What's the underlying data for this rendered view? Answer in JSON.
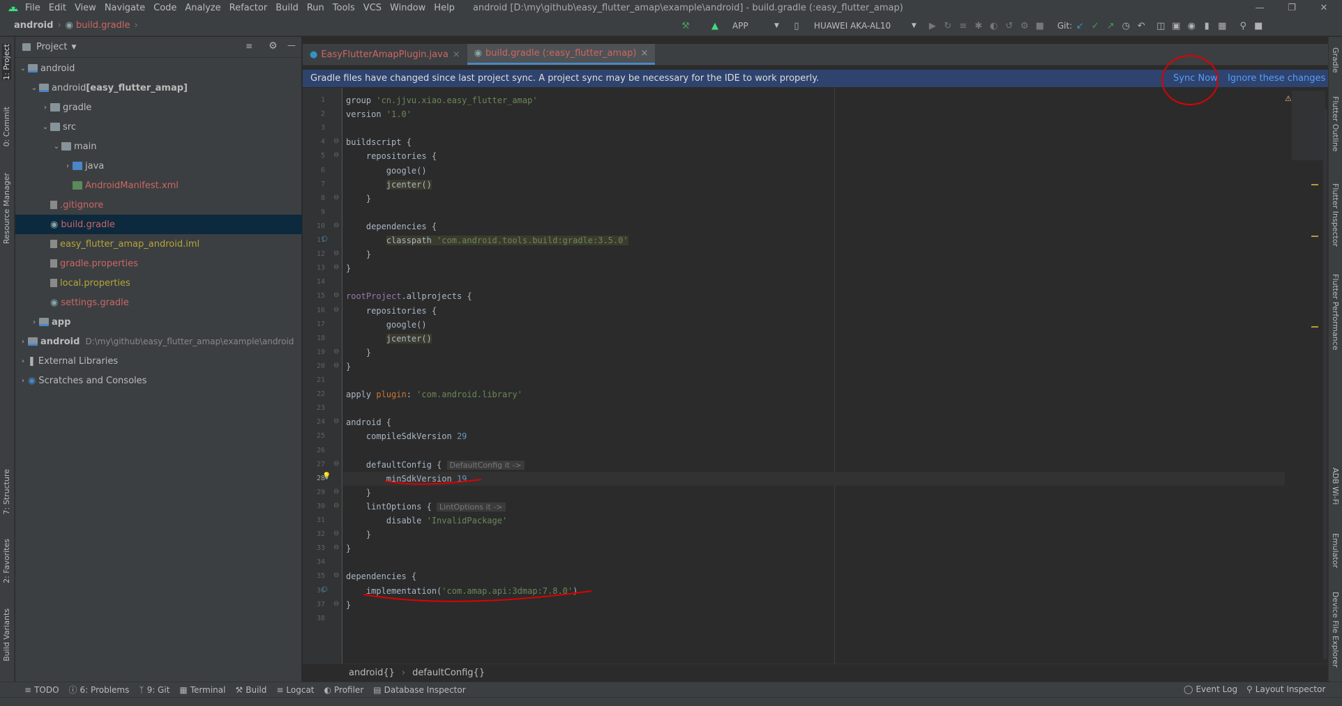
{
  "menubar": {
    "items": [
      "File",
      "Edit",
      "View",
      "Navigate",
      "Code",
      "Analyze",
      "Refactor",
      "Build",
      "Run",
      "Tools",
      "VCS",
      "Window",
      "Help"
    ],
    "window_title": "android [D:\\my\\github\\easy_flutter_amap\\example\\android] - build.gradle (:easy_flutter_amap)"
  },
  "navbar": {
    "crumb_root": "android",
    "crumb_file": "build.gradle",
    "run_config": "APP",
    "device": "HUAWEI AKA-AL10",
    "git_label": "Git:"
  },
  "left_strip": {
    "tabs": [
      "1: Project",
      "0: Commit",
      "Resource Manager",
      "7: Structure",
      "2: Favorites",
      "Build Variants"
    ]
  },
  "right_strip": {
    "tabs": [
      "Gradle",
      "Flutter Outline",
      "Flutter Inspector",
      "Flutter Performance",
      "ADB Wi-Fi",
      "Emulator",
      "Device File Explorer"
    ]
  },
  "project": {
    "title": "Project",
    "tree": [
      {
        "label": "android",
        "extra": "",
        "color": "#bbbbbb"
      },
      {
        "label": "android",
        "extra": " [easy_flutter_amap]",
        "color": "#bbbbbb"
      },
      {
        "label": "gradle",
        "extra": "",
        "color": "#bbbbbb"
      },
      {
        "label": "src",
        "extra": "",
        "color": "#bbbbbb"
      },
      {
        "label": "main",
        "extra": "",
        "color": "#bbbbbb"
      },
      {
        "label": "java",
        "extra": "",
        "color": "#bbbbbb"
      },
      {
        "label": "AndroidManifest.xml",
        "extra": "",
        "color": "#cc6666"
      },
      {
        "label": ".gitignore",
        "extra": "",
        "color": "#cc6666"
      },
      {
        "label": "build.gradle",
        "extra": "",
        "color": "#cc6666"
      },
      {
        "label": "easy_flutter_amap_android.iml",
        "extra": "",
        "color": "#b5a638"
      },
      {
        "label": "gradle.properties",
        "extra": "",
        "color": "#cc6666"
      },
      {
        "label": "local.properties",
        "extra": "",
        "color": "#b5a638"
      },
      {
        "label": "settings.gradle",
        "extra": "",
        "color": "#cc6666"
      },
      {
        "label": "app",
        "extra": "",
        "color": "#bbbbbb"
      },
      {
        "label": "android",
        "extra": "D:\\my\\github\\easy_flutter_amap\\example\\android",
        "color": "#bbbbbb"
      },
      {
        "label": "External Libraries",
        "extra": "",
        "color": "#bbbbbb"
      },
      {
        "label": "Scratches and Consoles",
        "extra": "",
        "color": "#bbbbbb"
      }
    ]
  },
  "tabs": [
    {
      "label": "EasyFlutterAmapPlugin.java"
    },
    {
      "label": "build.gradle (:easy_flutter_amap)"
    }
  ],
  "notification": {
    "message": "Gradle files have changed since last project sync. A project sync may be necessary for the IDE to work properly.",
    "sync_now": "Sync Now",
    "ignore": "Ignore these changes"
  },
  "inspection": {
    "count": "3"
  },
  "code_lines": [
    "group 'cn.jjvu.xiao.easy_flutter_amap'",
    "version '1.0'",
    "",
    "buildscript {",
    "    repositories {",
    "        google()",
    "        jcenter()",
    "    }",
    "",
    "    dependencies {",
    "        classpath 'com.android.tools.build:gradle:3.5.0'",
    "    }",
    "}",
    "",
    "rootProject.allprojects {",
    "    repositories {",
    "        google()",
    "        jcenter()",
    "    }",
    "}",
    "",
    "apply plugin: 'com.android.library'",
    "",
    "android {",
    "    compileSdkVersion 29",
    "",
    "    defaultConfig { DefaultConfig it ->",
    "        minSdkVersion 19",
    "    }",
    "    lintOptions { LintOptions it ->",
    "        disable 'InvalidPackage'",
    "    }",
    "}",
    "",
    "dependencies {",
    "    implementation('com.amap.api:3dmap:7.8.0')",
    "}",
    ""
  ],
  "editor_crumbs": {
    "first": "android{}",
    "second": "defaultConfig{}"
  },
  "bottom_tabs": [
    "TODO",
    "6: Problems",
    "9: Git",
    "Terminal",
    "Build",
    "Logcat",
    "Profiler",
    "Database Inspector"
  ],
  "bottom_right": [
    "Event Log",
    "Layout Inspector"
  ]
}
